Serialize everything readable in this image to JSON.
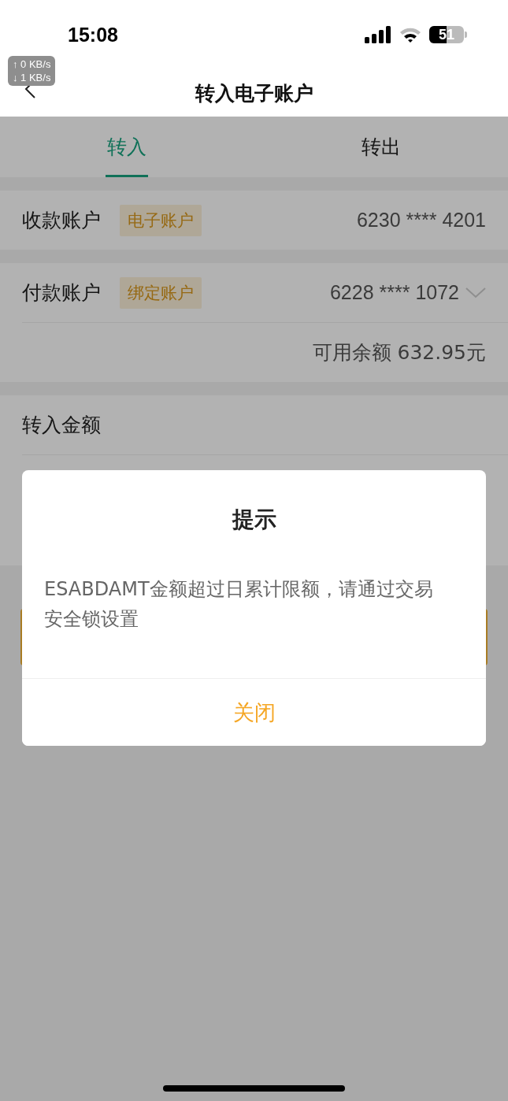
{
  "status_bar": {
    "time": "15:08",
    "battery_text": "51",
    "net_up": "↑ 0 KB/s",
    "net_down": "↓ 1 KB/s"
  },
  "nav": {
    "title": "转入电子账户"
  },
  "tabs": [
    {
      "label": "转入",
      "selected": true
    },
    {
      "label": "转出",
      "selected": false
    }
  ],
  "payee": {
    "label": "收款账户",
    "tag": "电子账户",
    "account": "6230 **** 4201"
  },
  "payer": {
    "label": "付款账户",
    "tag": "绑定账户",
    "account": "6228 **** 1072",
    "balance": "可用余额 632.95元"
  },
  "amount": {
    "label": "转入金额"
  },
  "dialog": {
    "title": "提示",
    "message": "ESABDAMT金额超过日累计限额，请通过交易安全锁设置",
    "button": "关闭"
  }
}
